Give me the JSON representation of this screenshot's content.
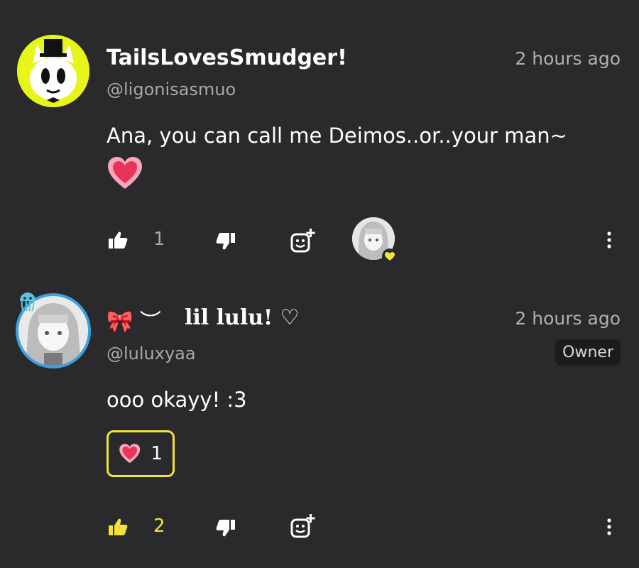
{
  "comments": [
    {
      "author": "TailsLovesSmudger!",
      "handle": "@ligonisasmuo",
      "time": "2 hours ago",
      "text": "Ana, you can call me Deimos..or..your man~",
      "likes": "1",
      "colors": {
        "avatar_bg": "#e8f51a"
      }
    },
    {
      "author_prefix": "🎀 ︶",
      "author": "lil lulu! ♡",
      "handle": "@luluxyaa",
      "time": "2 hours ago",
      "badge": "Owner",
      "text": "ooo okayy! :3",
      "reaction_count": "1",
      "likes": "2",
      "colors": {
        "like_active": "#f4e23a",
        "chip_border": "#f4e23a",
        "avatar_ring": "#3aa0e0"
      }
    }
  ]
}
